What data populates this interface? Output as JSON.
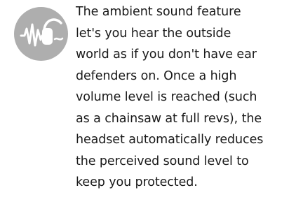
{
  "feature": {
    "icon": "ambient-sound-icon",
    "icon_color": "#aeaeae",
    "text_color": "#1a1a1a",
    "description_lines": [
      "The ambient sound feature",
      "let's you hear the outside",
      "world as if you don't have ear",
      "defenders on. Once a high",
      "volume level is reached (such",
      "as a chainsaw at full revs), the",
      "headset automatically reduces",
      "the perceived sound level to",
      "keep you protected."
    ]
  }
}
